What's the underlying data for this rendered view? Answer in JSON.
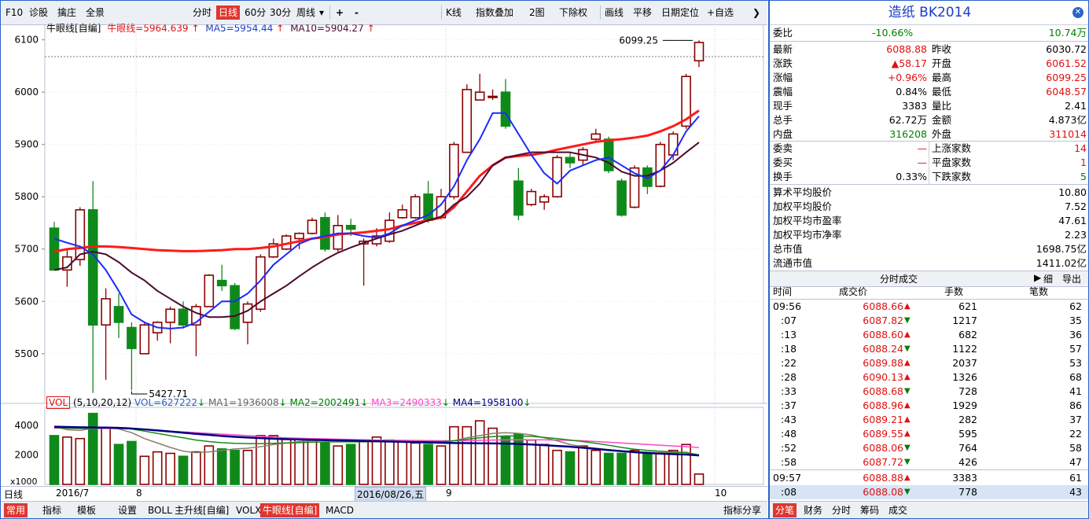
{
  "toolbar": {
    "items": [
      "F10",
      "诊股",
      "擒庄",
      "全景",
      "分时",
      "日线",
      "60分",
      "30分",
      "周线",
      "▾",
      "+",
      "-",
      "K线",
      "指数叠加",
      "2图",
      "下除权",
      "画线",
      "平移",
      "日期定位",
      "+自选",
      "❯"
    ],
    "selected": "日线"
  },
  "legend": {
    "selector": "牛眼线[自编]",
    "main": "牛眼线=5964.639",
    "ma5": "MA5=5954.44",
    "ma10": "MA10=5904.27"
  },
  "chart_data": {
    "type": "candlestick",
    "y_ticks": [
      6100,
      6000,
      5900,
      5800,
      5700,
      5600,
      5500
    ],
    "high_label": "6099.25",
    "low_label": "5427.71",
    "dates_x_labels": [
      "2016/7",
      "8",
      "2016/08/26,五",
      "9",
      "10"
    ],
    "candles": [
      {
        "o": 5740,
        "c": 5660,
        "h": 5752,
        "l": 5660
      },
      {
        "o": 5660,
        "c": 5685,
        "h": 5700,
        "l": 5628
      },
      {
        "o": 5680,
        "c": 5775,
        "h": 5780,
        "l": 5668
      },
      {
        "o": 5775,
        "c": 5555,
        "h": 5830,
        "l": 5425
      },
      {
        "o": 5555,
        "c": 5605,
        "h": 5625,
        "l": 5450
      },
      {
        "o": 5590,
        "c": 5560,
        "h": 5615,
        "l": 5530
      },
      {
        "o": 5550,
        "c": 5510,
        "h": 5560,
        "l": 5430
      },
      {
        "o": 5500,
        "c": 5555,
        "h": 5560,
        "l": 5500
      },
      {
        "o": 5540,
        "c": 5560,
        "h": 5562,
        "l": 5525
      },
      {
        "o": 5560,
        "c": 5585,
        "h": 5590,
        "l": 5520
      },
      {
        "o": 5585,
        "c": 5555,
        "h": 5600,
        "l": 5548
      },
      {
        "o": 5555,
        "c": 5590,
        "h": 5595,
        "l": 5495
      },
      {
        "o": 5590,
        "c": 5650,
        "h": 5652,
        "l": 5590
      },
      {
        "o": 5640,
        "c": 5630,
        "h": 5670,
        "l": 5620
      },
      {
        "o": 5630,
        "c": 5548,
        "h": 5635,
        "l": 5545
      },
      {
        "o": 5560,
        "c": 5595,
        "h": 5600,
        "l": 5518
      },
      {
        "o": 5585,
        "c": 5685,
        "h": 5690,
        "l": 5580
      },
      {
        "o": 5685,
        "c": 5710,
        "h": 5720,
        "l": 5683
      },
      {
        "o": 5700,
        "c": 5725,
        "h": 5728,
        "l": 5698
      },
      {
        "o": 5720,
        "c": 5730,
        "h": 5732,
        "l": 5700
      },
      {
        "o": 5730,
        "c": 5755,
        "h": 5760,
        "l": 5728
      },
      {
        "o": 5760,
        "c": 5700,
        "h": 5770,
        "l": 5695
      },
      {
        "o": 5700,
        "c": 5745,
        "h": 5765,
        "l": 5695
      },
      {
        "o": 5745,
        "c": 5738,
        "h": 5758,
        "l": 5725
      },
      {
        "o": 5710,
        "c": 5715,
        "h": 5720,
        "l": 5630
      },
      {
        "o": 5710,
        "c": 5725,
        "h": 5740,
        "l": 5705
      },
      {
        "o": 5715,
        "c": 5755,
        "h": 5770,
        "l": 5712
      },
      {
        "o": 5760,
        "c": 5775,
        "h": 5785,
        "l": 5758
      },
      {
        "o": 5760,
        "c": 5800,
        "h": 5805,
        "l": 5758
      },
      {
        "o": 5805,
        "c": 5755,
        "h": 5830,
        "l": 5750
      },
      {
        "o": 5760,
        "c": 5800,
        "h": 5815,
        "l": 5757
      },
      {
        "o": 5800,
        "c": 5900,
        "h": 5905,
        "l": 5795
      },
      {
        "o": 5885,
        "c": 6005,
        "h": 6015,
        "l": 5885
      },
      {
        "o": 5985,
        "c": 6000,
        "h": 6035,
        "l": 5985
      },
      {
        "o": 5990,
        "c": 5992,
        "h": 6005,
        "l": 5985
      },
      {
        "o": 6000,
        "c": 5935,
        "h": 6025,
        "l": 5930
      },
      {
        "o": 5830,
        "c": 5765,
        "h": 5855,
        "l": 5755
      },
      {
        "o": 5785,
        "c": 5810,
        "h": 5815,
        "l": 5782
      },
      {
        "o": 5790,
        "c": 5800,
        "h": 5805,
        "l": 5775
      },
      {
        "o": 5800,
        "c": 5875,
        "h": 5880,
        "l": 5798
      },
      {
        "o": 5875,
        "c": 5865,
        "h": 5885,
        "l": 5855
      },
      {
        "o": 5870,
        "c": 5890,
        "h": 5895,
        "l": 5860
      },
      {
        "o": 5910,
        "c": 5920,
        "h": 5930,
        "l": 5905
      },
      {
        "o": 5910,
        "c": 5850,
        "h": 5915,
        "l": 5845
      },
      {
        "o": 5830,
        "c": 5765,
        "h": 5835,
        "l": 5762
      },
      {
        "o": 5780,
        "c": 5855,
        "h": 5860,
        "l": 5778
      },
      {
        "o": 5855,
        "c": 5820,
        "h": 5860,
        "l": 5805
      },
      {
        "o": 5820,
        "c": 5900,
        "h": 5905,
        "l": 5818
      },
      {
        "o": 5880,
        "c": 5920,
        "h": 5925,
        "l": 5870
      },
      {
        "o": 5935,
        "c": 6030,
        "h": 6035,
        "l": 5930
      },
      {
        "o": 6060,
        "c": 6095,
        "h": 6099,
        "l": 6048
      }
    ],
    "ma5": [
      5720,
      5712,
      5705,
      5690,
      5660,
      5620,
      5575,
      5560,
      5550,
      5548,
      5550,
      5560,
      5580,
      5600,
      5600,
      5615,
      5640,
      5670,
      5690,
      5710,
      5720,
      5725,
      5730,
      5730,
      5725,
      5722,
      5730,
      5745,
      5755,
      5765,
      5785,
      5820,
      5870,
      5910,
      5960,
      5960,
      5920,
      5880,
      5845,
      5825,
      5850,
      5860,
      5870,
      5875,
      5860,
      5845,
      5835,
      5850,
      5880,
      5925,
      5954
    ],
    "ma10": [
      5660,
      5665,
      5690,
      5695,
      5690,
      5675,
      5655,
      5640,
      5620,
      5605,
      5590,
      5578,
      5570,
      5570,
      5572,
      5582,
      5600,
      5615,
      5630,
      5648,
      5665,
      5680,
      5693,
      5703,
      5712,
      5720,
      5728,
      5735,
      5745,
      5755,
      5762,
      5785,
      5800,
      5825,
      5860,
      5875,
      5880,
      5885,
      5885,
      5885,
      5885,
      5880,
      5875,
      5865,
      5848,
      5840,
      5840,
      5850,
      5865,
      5885,
      5904
    ],
    "bull": [
      5695,
      5700,
      5702,
      5705,
      5705,
      5704,
      5702,
      5700,
      5698,
      5697,
      5696,
      5696,
      5697,
      5698,
      5700,
      5700,
      5702,
      5705,
      5710,
      5715,
      5720,
      5723,
      5728,
      5730,
      5732,
      5735,
      5738,
      5745,
      5750,
      5755,
      5760,
      5780,
      5810,
      5840,
      5860,
      5875,
      5878,
      5880,
      5884,
      5890,
      5895,
      5900,
      5905,
      5908,
      5910,
      5913,
      5917,
      5925,
      5935,
      5948,
      5965
    ],
    "volume": [
      3300,
      3200,
      3100,
      4800,
      3800,
      2700,
      2900,
      1900,
      2200,
      2100,
      1900,
      2200,
      2600,
      2400,
      2300,
      2300,
      3300,
      3300,
      3100,
      3100,
      3000,
      2800,
      2600,
      2700,
      3000,
      3200,
      3000,
      2900,
      2800,
      2700,
      2600,
      3900,
      3900,
      4300,
      3800,
      3200,
      3400,
      3000,
      2700,
      2300,
      2200,
      2600,
      2300,
      2100,
      2100,
      2300,
      2100,
      2100,
      2300,
      2700,
      700
    ],
    "vol_ma1": [
      3900,
      3700,
      3650,
      3800,
      3850,
      3750,
      3500,
      3100,
      2800,
      2500,
      2250,
      2150,
      2200,
      2300,
      2400,
      2450,
      2550,
      2700,
      2800,
      2900,
      2950,
      2980,
      2950,
      2900,
      2900,
      2950,
      2950,
      2900,
      2850,
      2820,
      2800,
      2950,
      3150,
      3300,
      3450,
      3500,
      3450,
      3350,
      3150,
      2950,
      2700,
      2550,
      2450,
      2350,
      2250,
      2200,
      2180,
      2150,
      2150,
      2180,
      1936
    ],
    "vol_ma2": [
      3850,
      3800,
      3780,
      3800,
      3820,
      3820,
      3750,
      3600,
      3450,
      3300,
      3150,
      3000,
      2900,
      2820,
      2780,
      2760,
      2760,
      2780,
      2800,
      2820,
      2850,
      2870,
      2880,
      2880,
      2880,
      2890,
      2900,
      2900,
      2900,
      2900,
      2890,
      2950,
      3050,
      3150,
      3230,
      3280,
      3280,
      3250,
      3180,
      3100,
      3000,
      2900,
      2780,
      2650,
      2500,
      2380,
      2300,
      2250,
      2200,
      2150,
      2002
    ],
    "vol_ma3": [
      3800,
      3790,
      3780,
      3780,
      3780,
      3770,
      3750,
      3700,
      3650,
      3600,
      3550,
      3500,
      3450,
      3400,
      3350,
      3300,
      3250,
      3200,
      3150,
      3120,
      3100,
      3080,
      3060,
      3040,
      3020,
      3000,
      2990,
      2980,
      2970,
      2960,
      2950,
      2950,
      2960,
      2980,
      3000,
      3010,
      3020,
      3020,
      3010,
      3000,
      2980,
      2950,
      2900,
      2850,
      2800,
      2750,
      2700,
      2650,
      2600,
      2560,
      2490
    ],
    "vol_ma4": [
      3900,
      3880,
      3860,
      3850,
      3840,
      3820,
      3780,
      3720,
      3650,
      3580,
      3500,
      3420,
      3350,
      3280,
      3220,
      3170,
      3130,
      3090,
      3060,
      3040,
      3020,
      3000,
      2980,
      2960,
      2940,
      2920,
      2900,
      2880,
      2860,
      2840,
      2820,
      2800,
      2790,
      2780,
      2770,
      2760,
      2740,
      2700,
      2650,
      2600,
      2550,
      2480,
      2400,
      2320,
      2250,
      2180,
      2120,
      2080,
      2050,
      2020,
      1958
    ]
  },
  "vol_legend": {
    "selector": "VOL",
    "params": "(5,10,20,12)",
    "vol": "VOL=627222",
    "ma1": "MA1=1936008",
    "ma2": "MA2=2002491",
    "ma3": "MA3=2490333",
    "ma4": "MA4=1958100",
    "y_ticks": [
      "4000",
      "2000"
    ],
    "unit": "x1000"
  },
  "bottom_tabs": [
    "日线",
    "常用",
    "指标",
    "模板",
    "设置",
    "BOLL",
    "主升线[自编]",
    "VOLX",
    "牛眼线[自编]",
    "MACD",
    "指标分享"
  ],
  "right_panel": {
    "title": "造纸  BK2014",
    "webi": {
      "label": "委比",
      "pct": "-10.66%",
      "amt": "10.74万"
    },
    "left_rows": [
      {
        "label": "最新",
        "value": "6088.88",
        "cls": "red"
      },
      {
        "label": "涨跌",
        "value": "▲58.17",
        "cls": "red"
      },
      {
        "label": "涨幅",
        "value": "+0.96%",
        "cls": "red"
      },
      {
        "label": "震幅",
        "value": "0.84%",
        "cls": ""
      },
      {
        "label": "现手",
        "value": "3383",
        "cls": ""
      },
      {
        "label": "总手",
        "value": "62.72万",
        "cls": ""
      },
      {
        "label": "内盘",
        "value": "316208",
        "cls": "green"
      }
    ],
    "right_rows": [
      {
        "label": "昨收",
        "value": "6030.72",
        "cls": ""
      },
      {
        "label": "开盘",
        "value": "6061.52",
        "cls": "red"
      },
      {
        "label": "最高",
        "value": "6099.25",
        "cls": "red"
      },
      {
        "label": "最低",
        "value": "6048.57",
        "cls": "red"
      },
      {
        "label": "量比",
        "value": "2.41",
        "cls": ""
      },
      {
        "label": "金额",
        "value": "4.873亿",
        "cls": ""
      },
      {
        "label": "外盘",
        "value": "311014",
        "cls": "red"
      }
    ],
    "wm_left": [
      {
        "label": "委卖",
        "value": "—",
        "cls": "red"
      },
      {
        "label": "委买",
        "value": "—",
        "cls": "red"
      },
      {
        "label": "换手",
        "value": "0.33%",
        "cls": ""
      }
    ],
    "wm_right": [
      {
        "label": "上涨家数",
        "value": "14",
        "cls": "red"
      },
      {
        "label": "平盘家数",
        "value": "1",
        "cls": "red"
      },
      {
        "label": "下跌家数",
        "value": "5",
        "cls": "green"
      }
    ],
    "stats": [
      {
        "label": "算术平均股价",
        "value": "10.80"
      },
      {
        "label": "加权平均股价",
        "value": "7.52"
      },
      {
        "label": "加权平均市盈率",
        "value": "47.61"
      },
      {
        "label": "加权平均市净率",
        "value": "2.23"
      },
      {
        "label": "总市值",
        "value": "1698.75亿"
      },
      {
        "label": "流通市值",
        "value": "1411.02亿"
      }
    ],
    "tick_title": "分时成交",
    "tick_actions": [
      "▶",
      "细",
      "导出"
    ],
    "tick_cols": [
      "时间",
      "成交价",
      "手数",
      "笔数"
    ],
    "ticks": [
      {
        "t": "09:56",
        "p": "6088.66",
        "d": "▲",
        "v": "621",
        "n": "62"
      },
      {
        "t": ":07",
        "p": "6087.82",
        "d": "▼",
        "v": "1217",
        "n": "35"
      },
      {
        "t": ":13",
        "p": "6088.60",
        "d": "▲",
        "v": "682",
        "n": "36"
      },
      {
        "t": ":18",
        "p": "6088.24",
        "d": "▼",
        "v": "1122",
        "n": "57"
      },
      {
        "t": ":22",
        "p": "6089.88",
        "d": "▲",
        "v": "2037",
        "n": "53"
      },
      {
        "t": ":28",
        "p": "6090.13",
        "d": "▲",
        "v": "1326",
        "n": "68"
      },
      {
        "t": ":33",
        "p": "6088.68",
        "d": "▼",
        "v": "728",
        "n": "41"
      },
      {
        "t": ":37",
        "p": "6088.96",
        "d": "▲",
        "v": "1929",
        "n": "86"
      },
      {
        "t": ":43",
        "p": "6089.21",
        "d": "▲",
        "v": "282",
        "n": "37"
      },
      {
        "t": ":48",
        "p": "6089.55",
        "d": "▲",
        "v": "595",
        "n": "22"
      },
      {
        "t": ":52",
        "p": "6088.06",
        "d": "▼",
        "v": "764",
        "n": "58"
      },
      {
        "t": ":58",
        "p": "6087.72",
        "d": "▼",
        "v": "426",
        "n": "47"
      },
      {
        "t": "09:57",
        "p": "6088.88",
        "d": "▲",
        "v": "3383",
        "n": "61"
      },
      {
        "t": ":08",
        "p": "6088.08",
        "d": "▼",
        "v": "778",
        "n": "43"
      }
    ],
    "tabs": [
      "分笔",
      "财务",
      "分时",
      "筹码",
      "成交"
    ]
  }
}
